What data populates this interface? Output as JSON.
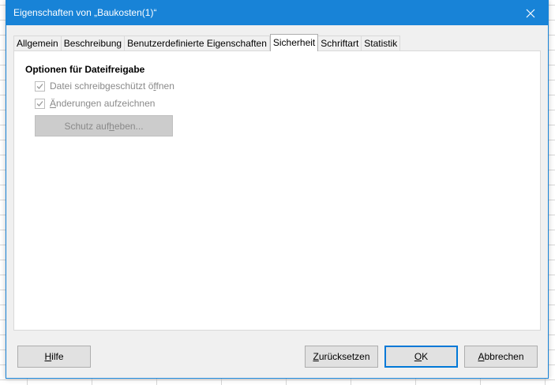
{
  "window": {
    "title": "Eigenschaften von „Baukosten(1)“"
  },
  "tabs": [
    {
      "label": "Allgemein",
      "active": false
    },
    {
      "label": "Beschreibung",
      "active": false
    },
    {
      "label": "Benutzerdefinierte Eigenschaften",
      "active": false
    },
    {
      "label": "Sicherheit",
      "active": true
    },
    {
      "label": "Schriftart",
      "active": false
    },
    {
      "label": "Statistik",
      "active": false
    }
  ],
  "security": {
    "section_title": "Optionen für Dateifreigabe",
    "options": [
      {
        "pre": "Datei schreibgeschützt ö",
        "u": "f",
        "post": "fnen",
        "checked": true,
        "enabled": false
      },
      {
        "pre": "",
        "u": "Ä",
        "post": "nderungen aufzeichnen",
        "checked": true,
        "enabled": false
      }
    ],
    "unprotect_button": {
      "pre": "Schutz auf",
      "u": "h",
      "post": "eben...",
      "enabled": false
    }
  },
  "buttons": {
    "help": {
      "pre": "",
      "u": "H",
      "post": "ilfe"
    },
    "reset": {
      "pre": "",
      "u": "Z",
      "post": "urücksetzen"
    },
    "ok": {
      "pre": "",
      "u": "O",
      "post": "K"
    },
    "cancel": {
      "pre": "",
      "u": "A",
      "post": "bbrechen"
    }
  },
  "colors": {
    "titlebar": "#1883d7",
    "dialog_bg": "#f0f0f0",
    "default_button_border": "#0078d7"
  }
}
